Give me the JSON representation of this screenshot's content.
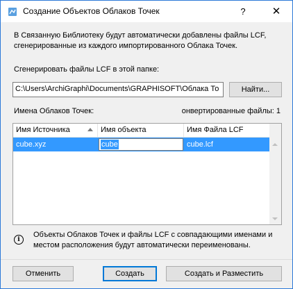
{
  "window": {
    "title": "Создание Объектов Облаков Точек",
    "help_label": "?",
    "close_label": "✕"
  },
  "description": "В Связанную Библиотеку будут автоматически добавлены файлы LCF, сгенерированные из каждого импортированного Облака Точек.",
  "folder": {
    "label": "Сгенерировать файлы LCF в этой папке:",
    "path": "C:\\Users\\ArchiGraphi\\Documents\\GRAPHISOFT\\Облака То",
    "find_button": "Найти..."
  },
  "table_section": {
    "names_label": "Имена Облаков Точек:",
    "converted_label": "онвертированные файлы: 1"
  },
  "table": {
    "columns": [
      "Имя Источника",
      "Имя объекта",
      "Имя Файла LCF"
    ],
    "rows": [
      {
        "source": "cube.xyz",
        "object": "cube",
        "lcf": "cube.lcf"
      }
    ]
  },
  "info": {
    "icon": "info-icon",
    "text": "Объекты Облаков Точек и файлы LCF с совпадающими именами и местом расположения будут автоматически переименованы."
  },
  "buttons": {
    "cancel": "Отменить",
    "create": "Создать",
    "create_and_place": "Создать и Разместить"
  },
  "colors": {
    "accent": "#0078d7",
    "selection": "#3399ff",
    "window_border": "#2b79d8"
  }
}
